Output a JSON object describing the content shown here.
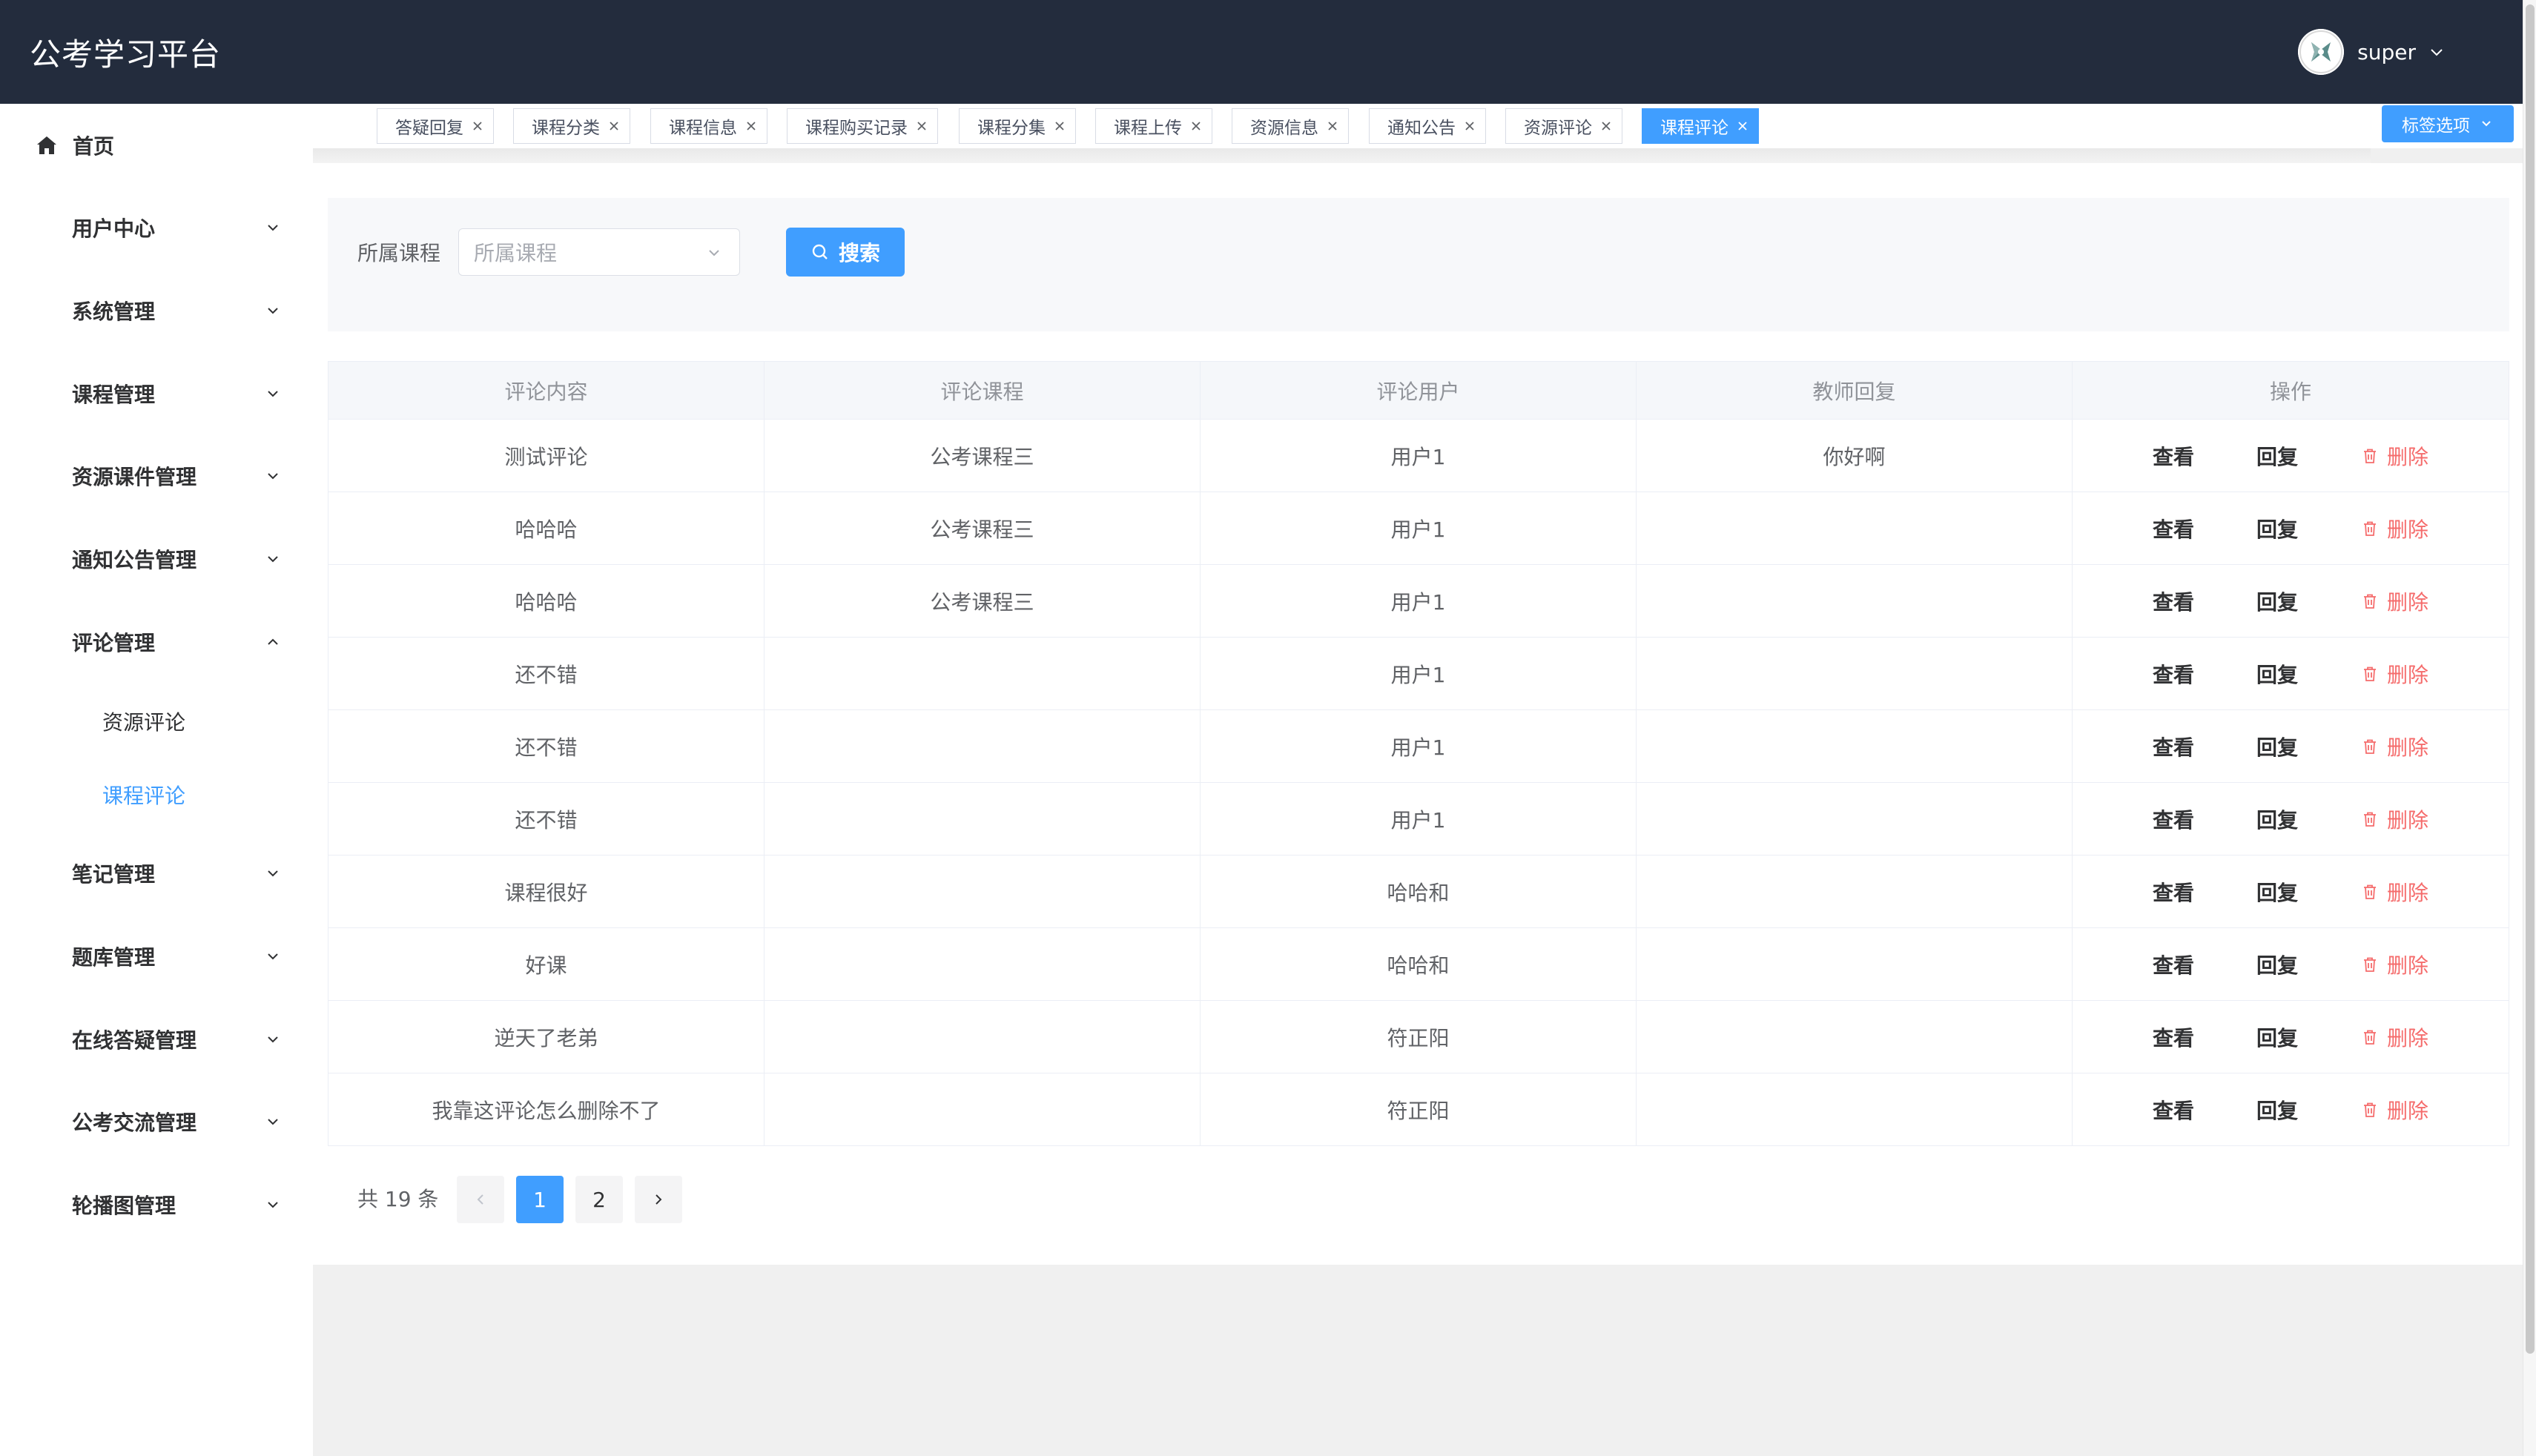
{
  "app": {
    "title": "公考学习平台"
  },
  "user": {
    "name": "super"
  },
  "sidebar": {
    "home": "首页",
    "groups": [
      "用户中心",
      "系统管理",
      "课程管理",
      "资源课件管理",
      "通知公告管理",
      "评论管理",
      "笔记管理",
      "题库管理",
      "在线答疑管理",
      "公考交流管理",
      "轮播图管理"
    ],
    "sub": [
      "资源评论",
      "课程评论"
    ]
  },
  "tabs": [
    "答疑回复",
    "课程分类",
    "课程信息",
    "课程购买记录",
    "课程分集",
    "课程上传",
    "资源信息",
    "通知公告",
    "资源评论",
    "课程评论"
  ],
  "tab_options": "标签选项",
  "search": {
    "label": "所属课程",
    "placeholder": "所属课程",
    "button": "搜索"
  },
  "table": {
    "columns": [
      "评论内容",
      "评论课程",
      "评论用户",
      "教师回复",
      "操作"
    ],
    "rows": [
      [
        "测试评论",
        "公考课程三",
        "用户1",
        "你好啊"
      ],
      [
        "哈哈哈",
        "公考课程三",
        "用户1",
        ""
      ],
      [
        "哈哈哈",
        "公考课程三",
        "用户1",
        ""
      ],
      [
        "还不错",
        "",
        "用户1",
        ""
      ],
      [
        "还不错",
        "",
        "用户1",
        ""
      ],
      [
        "还不错",
        "",
        "用户1",
        ""
      ],
      [
        "课程很好",
        "",
        "哈哈和",
        ""
      ],
      [
        "好课",
        "",
        "哈哈和",
        ""
      ],
      [
        "逆天了老弟",
        "",
        "符正阳",
        ""
      ],
      [
        "我靠这评论怎么删除不了",
        "",
        "符正阳",
        ""
      ]
    ],
    "actions": {
      "view": "查看",
      "reply": "回复",
      "delete": "删除"
    }
  },
  "pagination": {
    "total_text": "共 19 条",
    "pages": [
      "1",
      "2"
    ]
  },
  "colors": {
    "header_bg": "#232c3d",
    "primary": "#409eff",
    "danger": "#f56c6c"
  }
}
